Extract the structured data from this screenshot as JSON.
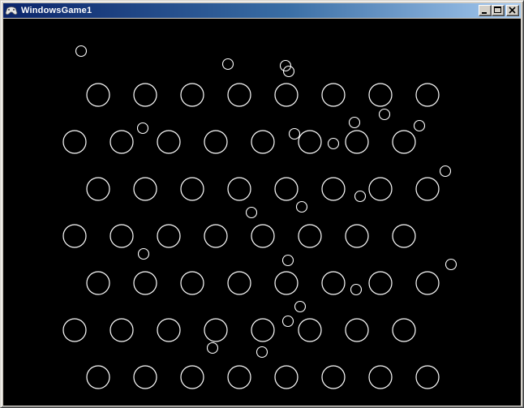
{
  "window": {
    "title": "WindowsGame1",
    "title_icon": "gamepad-icon",
    "buttons": [
      "minimize-icon",
      "maximize-icon",
      "close-icon"
    ]
  },
  "game": {
    "background_color": "#000000",
    "stroke_color": "#ffffff"
  }
}
